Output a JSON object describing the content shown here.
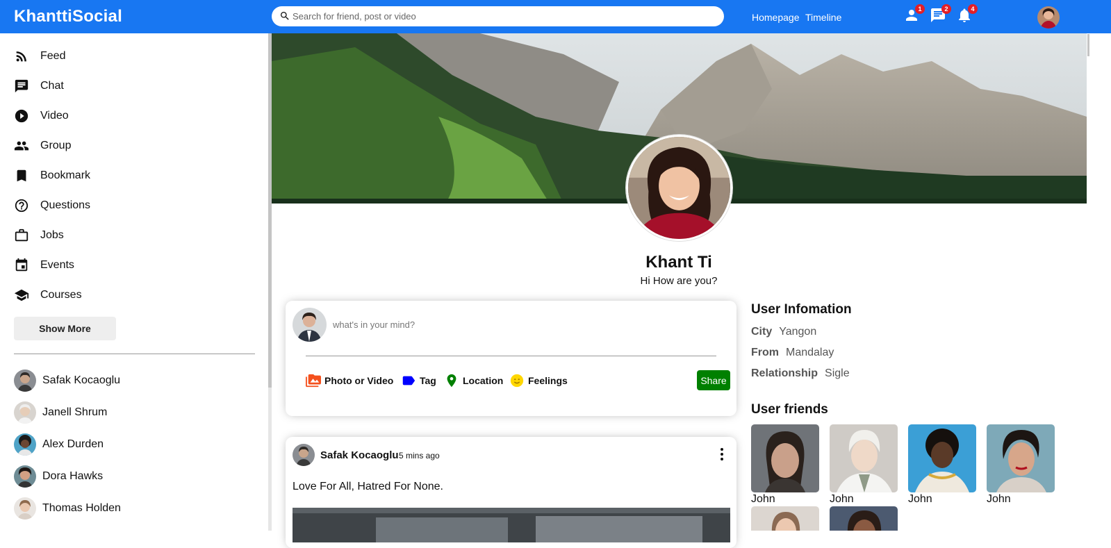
{
  "app": {
    "logo": "KhanttiSocial"
  },
  "search": {
    "placeholder": "Search for friend, post or video"
  },
  "topnav": {
    "links": [
      "Homepage",
      "Timeline"
    ],
    "badges": {
      "friends": "1",
      "messages": "2",
      "notifications": "4"
    }
  },
  "colors": {
    "topbar": "#1877f2",
    "badge": "#e41e26",
    "share_button": "#008000"
  },
  "sidebar": {
    "items": [
      {
        "label": "Feed",
        "icon": "rss-icon"
      },
      {
        "label": "Chat",
        "icon": "chat-icon"
      },
      {
        "label": "Video",
        "icon": "play-circle-icon"
      },
      {
        "label": "Group",
        "icon": "group-icon"
      },
      {
        "label": "Bookmark",
        "icon": "bookmark-icon"
      },
      {
        "label": "Questions",
        "icon": "help-circle-icon"
      },
      {
        "label": "Jobs",
        "icon": "briefcase-icon"
      },
      {
        "label": "Events",
        "icon": "calendar-icon"
      },
      {
        "label": "Courses",
        "icon": "school-icon"
      }
    ],
    "show_more": "Show More",
    "friends": [
      "Safak Kocaoglu",
      "Janell Shrum",
      "Alex Durden",
      "Dora Hawks",
      "Thomas Holden"
    ]
  },
  "profile": {
    "name": "Khant Ti",
    "description": "Hi How are you?"
  },
  "share": {
    "placeholder": "what's in your mind?",
    "options": [
      {
        "label": "Photo or Video",
        "icon": "perm-media-icon"
      },
      {
        "label": "Tag",
        "icon": "label-icon"
      },
      {
        "label": "Location",
        "icon": "room-icon"
      },
      {
        "label": "Feelings",
        "icon": "emoji-icon"
      }
    ],
    "button": "Share"
  },
  "post": {
    "username": "Safak Kocaoglu",
    "time": "5 mins ago",
    "text": "Love For All, Hatred For None."
  },
  "user_info": {
    "title": "User Infomation",
    "rows": [
      {
        "key": "City",
        "value": "Yangon"
      },
      {
        "key": "From",
        "value": "Mandalay"
      },
      {
        "key": "Relationship",
        "value": "Sigle"
      }
    ]
  },
  "user_friends": {
    "title": "User friends",
    "names": [
      "John",
      "John",
      "John",
      "John"
    ]
  }
}
